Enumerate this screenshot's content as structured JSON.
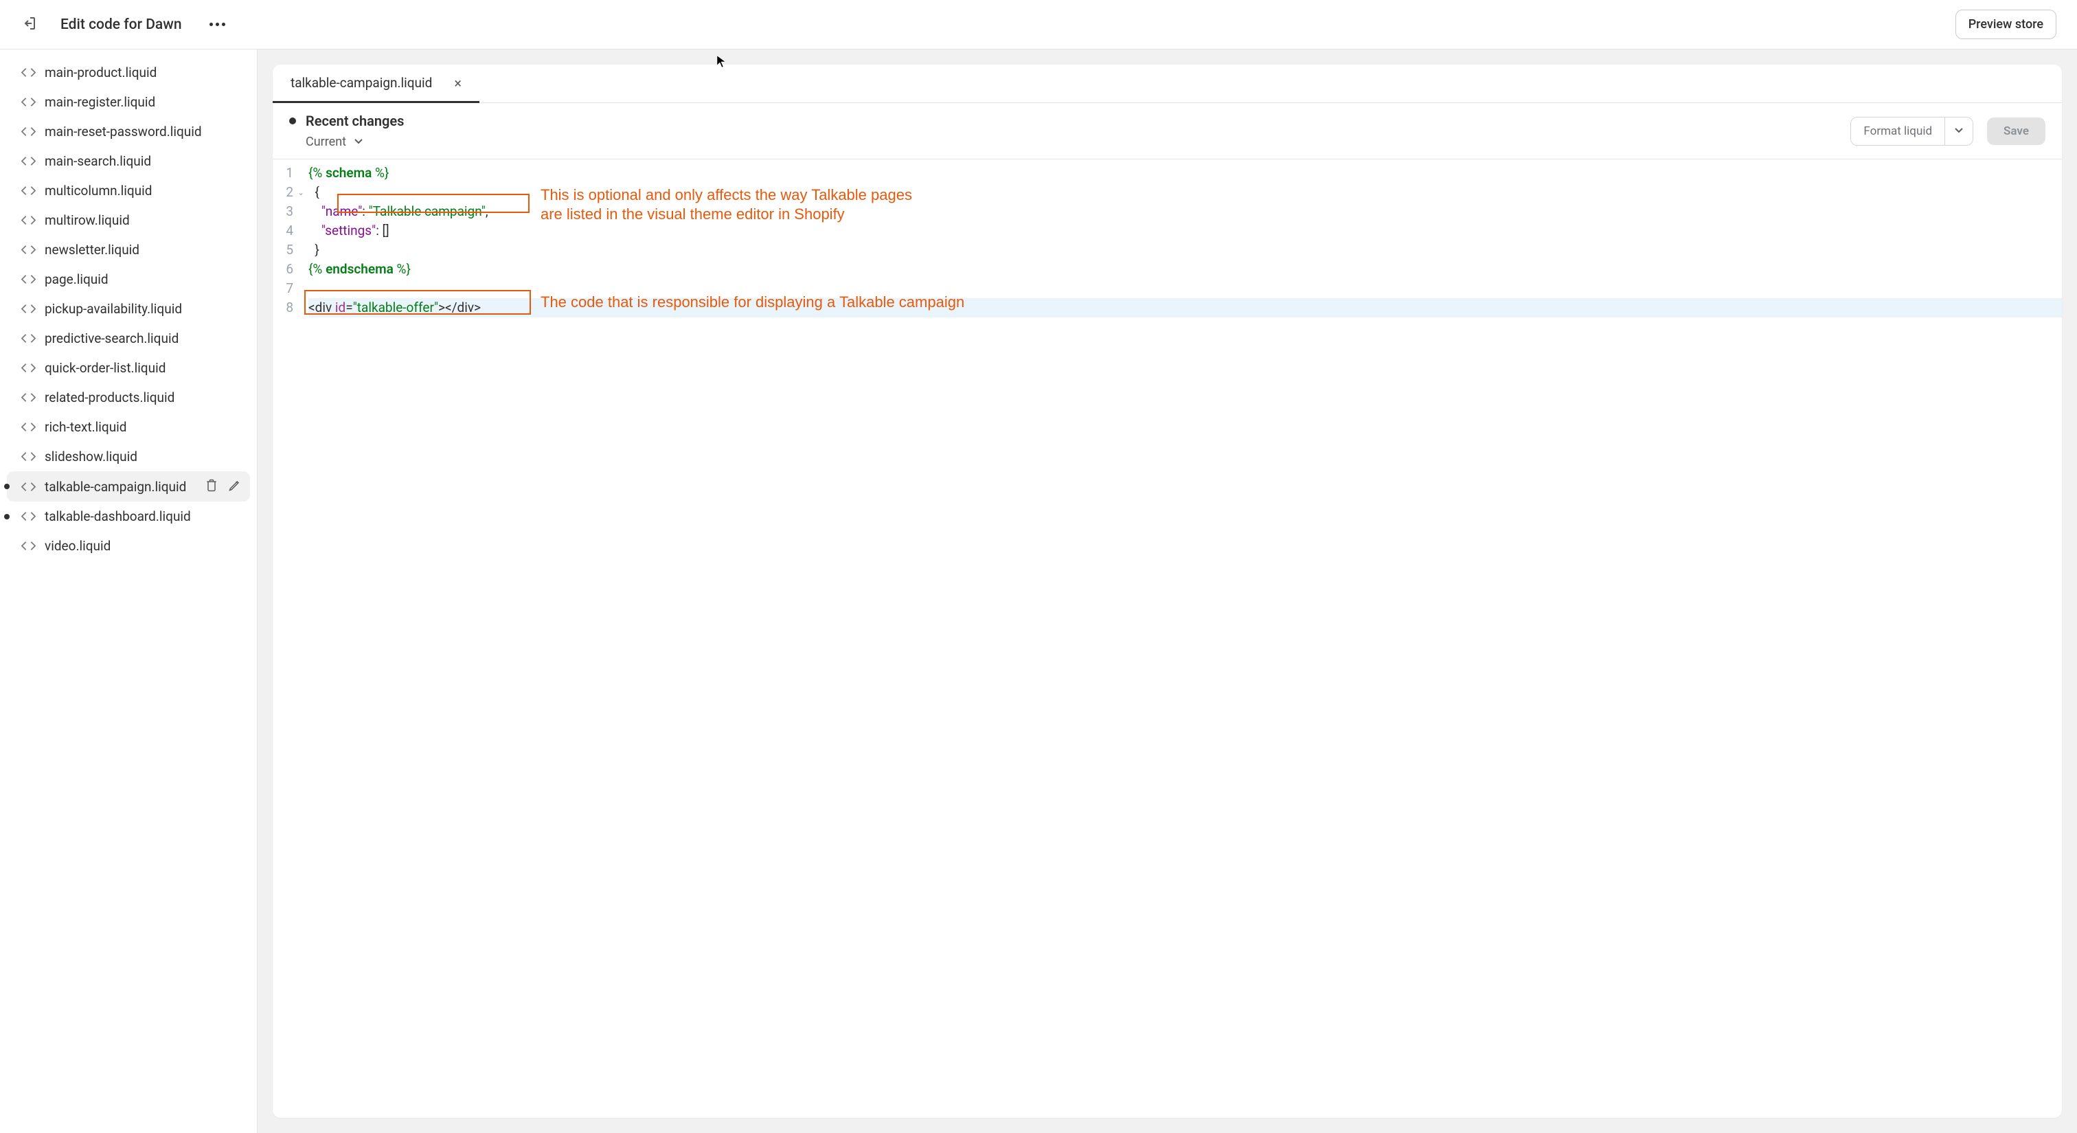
{
  "header": {
    "title": "Edit code for Dawn",
    "preview_button": "Preview store"
  },
  "sidebar": {
    "files": [
      {
        "name": "main-product.liquid",
        "modified": false,
        "active": false,
        "show_actions": false
      },
      {
        "name": "main-register.liquid",
        "modified": false,
        "active": false,
        "show_actions": false
      },
      {
        "name": "main-reset-password.liquid",
        "modified": false,
        "active": false,
        "show_actions": false
      },
      {
        "name": "main-search.liquid",
        "modified": false,
        "active": false,
        "show_actions": false
      },
      {
        "name": "multicolumn.liquid",
        "modified": false,
        "active": false,
        "show_actions": false
      },
      {
        "name": "multirow.liquid",
        "modified": false,
        "active": false,
        "show_actions": false
      },
      {
        "name": "newsletter.liquid",
        "modified": false,
        "active": false,
        "show_actions": false
      },
      {
        "name": "page.liquid",
        "modified": false,
        "active": false,
        "show_actions": false
      },
      {
        "name": "pickup-availability.liquid",
        "modified": false,
        "active": false,
        "show_actions": false
      },
      {
        "name": "predictive-search.liquid",
        "modified": false,
        "active": false,
        "show_actions": false
      },
      {
        "name": "quick-order-list.liquid",
        "modified": false,
        "active": false,
        "show_actions": false
      },
      {
        "name": "related-products.liquid",
        "modified": false,
        "active": false,
        "show_actions": false
      },
      {
        "name": "rich-text.liquid",
        "modified": false,
        "active": false,
        "show_actions": false
      },
      {
        "name": "slideshow.liquid",
        "modified": false,
        "active": false,
        "show_actions": false
      },
      {
        "name": "talkable-campaign.liquid",
        "modified": true,
        "active": true,
        "show_actions": true
      },
      {
        "name": "talkable-dashboard.liquid",
        "modified": true,
        "active": false,
        "show_actions": false
      },
      {
        "name": "video.liquid",
        "modified": false,
        "active": false,
        "show_actions": false
      }
    ]
  },
  "editor": {
    "tab_name": "talkable-campaign.liquid",
    "recent_changes_label": "Recent changes",
    "current_label": "Current",
    "format_button": "Format liquid",
    "save_button": "Save",
    "line_numbers": [
      "1",
      "2",
      "3",
      "4",
      "5",
      "6",
      "7",
      "8"
    ],
    "code": {
      "l1_open": "{% ",
      "l1_kw": "schema",
      "l1_close": " %}",
      "l2": "  {",
      "l3_indent": "    ",
      "l3_key": "\"name\"",
      "l3_colon": ": ",
      "l3_val": "\"Talkable campaign\"",
      "l3_comma": ",",
      "l4_indent": "    ",
      "l4_key": "\"settings\"",
      "l4_colon": ": ",
      "l4_val": "[]",
      "l5": "  }",
      "l6_open": "{% ",
      "l6_kw": "endschema",
      "l6_close": " %}",
      "l8_open": "<div ",
      "l8_attr": "id",
      "l8_eq": "=",
      "l8_val": "\"talkable-offer\"",
      "l8_close": "></div>"
    }
  },
  "annotations": {
    "a1": "This is optional and only affects the way Talkable pages\nare listed in the visual theme editor in Shopify",
    "a2": "The code that is responsible for displaying a Talkable campaign"
  }
}
